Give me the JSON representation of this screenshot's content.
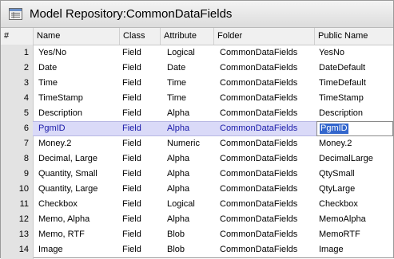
{
  "window": {
    "title": "Model Repository:CommonDataFields"
  },
  "columns": [
    "#",
    "Name",
    "Class",
    "Attribute",
    "Folder",
    "Public Name"
  ],
  "rows": [
    {
      "n": "1",
      "name": "Yes/No",
      "cls": "Field",
      "attr": "Logical",
      "folder": "CommonDataFields",
      "pub": "YesNo"
    },
    {
      "n": "2",
      "name": "Date",
      "cls": "Field",
      "attr": "Date",
      "folder": "CommonDataFields",
      "pub": "DateDefault"
    },
    {
      "n": "3",
      "name": "Time",
      "cls": "Field",
      "attr": "Time",
      "folder": "CommonDataFields",
      "pub": "TimeDefault"
    },
    {
      "n": "4",
      "name": "TimeStamp",
      "cls": "Field",
      "attr": "Time",
      "folder": "CommonDataFields",
      "pub": "TimeStamp"
    },
    {
      "n": "5",
      "name": "Description",
      "cls": "Field",
      "attr": "Alpha",
      "folder": "CommonDataFields",
      "pub": "Description"
    },
    {
      "n": "6",
      "name": "PgmID",
      "cls": "Field",
      "attr": "Alpha",
      "folder": "CommonDataFields",
      "pub": "PgmID"
    },
    {
      "n": "7",
      "name": "Money.2",
      "cls": "Field",
      "attr": "Numeric",
      "folder": "CommonDataFields",
      "pub": "Money.2"
    },
    {
      "n": "8",
      "name": "Decimal, Large",
      "cls": "Field",
      "attr": "Alpha",
      "folder": "CommonDataFields",
      "pub": "DecimalLarge"
    },
    {
      "n": "9",
      "name": "Quantity, Small",
      "cls": "Field",
      "attr": "Alpha",
      "folder": "CommonDataFields",
      "pub": "QtySmall"
    },
    {
      "n": "10",
      "name": "Quantity, Large",
      "cls": "Field",
      "attr": "Alpha",
      "folder": "CommonDataFields",
      "pub": "QtyLarge"
    },
    {
      "n": "11",
      "name": "Checkbox",
      "cls": "Field",
      "attr": "Logical",
      "folder": "CommonDataFields",
      "pub": "Checkbox"
    },
    {
      "n": "12",
      "name": "Memo, Alpha",
      "cls": "Field",
      "attr": "Alpha",
      "folder": "CommonDataFields",
      "pub": "MemoAlpha"
    },
    {
      "n": "13",
      "name": "Memo, RTF",
      "cls": "Field",
      "attr": "Blob",
      "folder": "CommonDataFields",
      "pub": "MemoRTF"
    },
    {
      "n": "14",
      "name": "Image",
      "cls": "Field",
      "attr": "Blob",
      "folder": "CommonDataFields",
      "pub": "Image"
    }
  ],
  "selected_row": "6",
  "colors": {
    "selection_band": "#dadaf8",
    "selection_text": "#1a1aa8",
    "edit_highlight": "#3366cc"
  },
  "icons": {
    "title": "repository-icon"
  }
}
